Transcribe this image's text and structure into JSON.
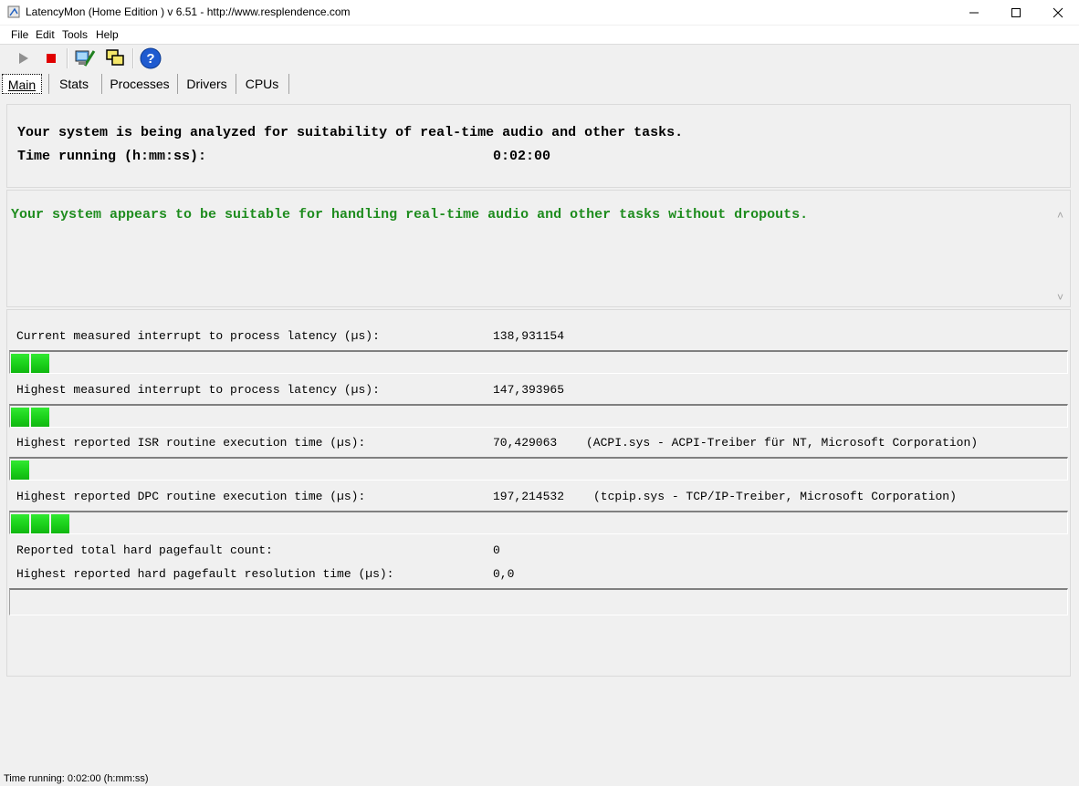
{
  "window": {
    "title": "LatencyMon  (Home Edition )  v 6.51 - http://www.resplendence.com",
    "minimize_glyph": "—",
    "maximize_glyph": "☐",
    "close_glyph": "✕"
  },
  "menu": [
    "File",
    "Edit",
    "Tools",
    "Help"
  ],
  "toolbar": {
    "buttons": [
      "play-icon",
      "stop-icon",
      "monitor-icon",
      "windows-icon",
      "help-icon"
    ],
    "help_glyph": "?"
  },
  "tabs": [
    "Main",
    "Stats",
    "Processes",
    "Drivers",
    "CPUs"
  ],
  "active_tab": "Main",
  "analysis": {
    "line1": "Your system is being analyzed for suitability of real-time audio and other tasks.",
    "line2_label": "Time running (h:mm:ss):",
    "line2_value": "0:02:00"
  },
  "verdict": {
    "text": "Your system appears to be suitable for handling real-time audio and other tasks without dropouts.",
    "color": "#1e8c1e"
  },
  "metrics": [
    {
      "label": "Current measured interrupt to process latency (µs):",
      "value": "138,931154",
      "detail": "",
      "bar_segments": 2
    },
    {
      "label": "Highest measured interrupt to process latency (µs):",
      "value": "147,393965",
      "detail": "",
      "bar_segments": 2
    },
    {
      "label": "Highest reported ISR routine execution time (µs):",
      "value": "70,429063",
      "detail": "(ACPI.sys - ACPI-Treiber für NT, Microsoft Corporation)",
      "bar_segments": 1
    },
    {
      "label": "Highest reported DPC routine execution time (µs):",
      "value": "197,214532",
      "detail": "(tcpip.sys - TCP/IP-Treiber, Microsoft Corporation)",
      "bar_segments": 3
    }
  ],
  "pagefault": {
    "count_label": "Reported total hard pagefault count:",
    "count_value": "0",
    "time_label": "Highest reported hard pagefault resolution time (µs):",
    "time_value": "0,0",
    "bar_segments": 0
  },
  "scroll": {
    "up_glyph": "˄",
    "down_glyph": "˅"
  },
  "statusbar": {
    "text": "Time running: 0:02:00  (h:mm:ss)"
  },
  "colors": {
    "bar_green": "#1cd21c",
    "stop_red": "#e00000",
    "help_blue": "#1f5bd0"
  }
}
